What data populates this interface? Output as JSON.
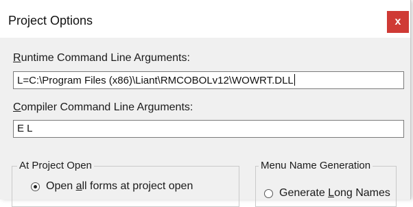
{
  "window": {
    "title": "Project Options",
    "close_glyph": "x"
  },
  "runtime": {
    "label": "Runtime Command Line Arguments:",
    "value": "L=C:\\Program Files (x86)\\Liant\\RMCOBOLv12\\WOWRT.DLL"
  },
  "compiler": {
    "label": "Compiler Command Line Arguments:",
    "value": "E L"
  },
  "project_open": {
    "legend": "At Project Open",
    "option_label": "Open all forms at project open",
    "option_checked": true
  },
  "menu_name": {
    "legend": "Menu Name Generation",
    "option_label": "Generate Long Names",
    "option_checked": false
  },
  "icons": {
    "close": "close-icon",
    "radio_checked": "radio-checked-icon",
    "radio_unchecked": "radio-unchecked-icon"
  }
}
